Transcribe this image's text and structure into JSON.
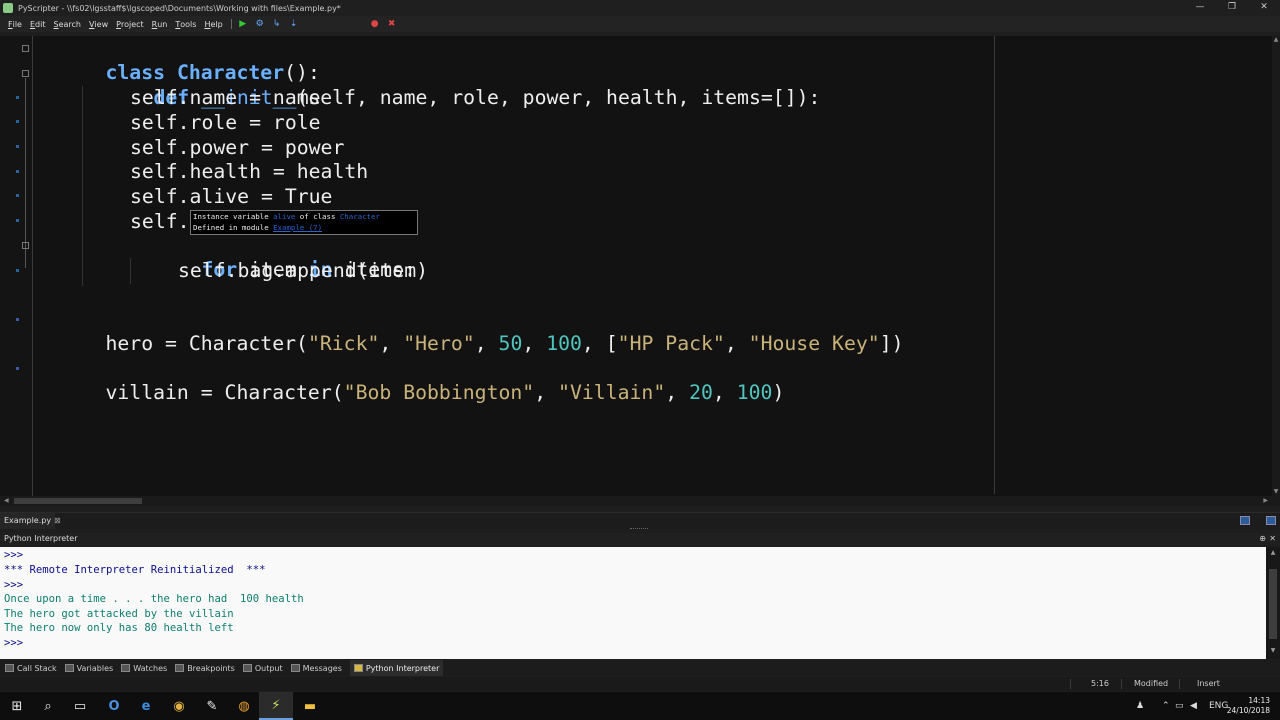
{
  "window": {
    "title": "PyScripter - \\\\fs02\\lgsstaff$\\lgscoped\\Documents\\Working with files\\Example.py*",
    "minimize": "—",
    "restore": "❐",
    "close": "✕"
  },
  "menu": {
    "items": [
      {
        "first": "F",
        "rest": "ile"
      },
      {
        "first": "E",
        "rest": "dit"
      },
      {
        "first": "S",
        "rest": "earch"
      },
      {
        "first": "V",
        "rest": "iew"
      },
      {
        "first": "P",
        "rest": "roject"
      },
      {
        "first": "R",
        "rest": "un"
      },
      {
        "first": "T",
        "rest": "ools"
      },
      {
        "first": "H",
        "rest": "elp"
      }
    ],
    "toolbar_icons": [
      "run-icon",
      "debug-icon",
      "step-into-icon",
      "step-over-icon",
      "abort-icon",
      "clear-breakpoints-icon"
    ]
  },
  "editor": {
    "lines": [
      [
        "class",
        " ",
        "Character",
        "():"
      ],
      [
        "def",
        " ",
        "__init__",
        "(self, name, role, power, health, items=[]):"
      ],
      [
        "self.name = name"
      ],
      [
        "self.role = role"
      ],
      [
        "self.power = power"
      ],
      [
        "self.health = health"
      ],
      [
        "self.alive = ",
        "True"
      ],
      [
        "self."
      ],
      [
        "for",
        " item ",
        "in",
        " items:"
      ],
      [
        "self.bag.append(item)"
      ],
      [
        "hero = Character(",
        "\"Rick\"",
        ", ",
        "\"Hero\"",
        ", ",
        "50",
        ", ",
        "100",
        ", [",
        "\"HP Pack\"",
        ", ",
        "\"House Key\"",
        "])"
      ],
      [
        "villain = Character(",
        "\"Bob Bobbington\"",
        ", ",
        "\"Villain\"",
        ", ",
        "20",
        ", ",
        "100",
        ")"
      ]
    ]
  },
  "tooltip": {
    "line1_a": "Instance variable ",
    "line1_b": "alive",
    "line1_c": " of class ",
    "line1_d": "Character",
    "line2_a": "Defined in module ",
    "line2_b": "Example (7)"
  },
  "file_tab": {
    "name": "Example.py",
    "close": "⊠"
  },
  "interpreter": {
    "title": "Python Interpreter",
    "pin": "⊕",
    "close": "✕",
    "lines": [
      {
        "text": ">>>",
        "kind": "prompt"
      },
      {
        "text": "*** Remote Interpreter Reinitialized  ***",
        "kind": "sys"
      },
      {
        "text": ">>>",
        "kind": "prompt"
      },
      {
        "text": "Once upon a time . . . the hero had  100 health",
        "kind": "out"
      },
      {
        "text": "The hero got attacked by the villain",
        "kind": "out"
      },
      {
        "text": "The hero now only has 80 health left",
        "kind": "out"
      },
      {
        "text": ">>>",
        "kind": "prompt"
      }
    ]
  },
  "tool_tabs": [
    {
      "label": "Call Stack",
      "icon": "call-stack-icon"
    },
    {
      "label": "Variables",
      "icon": "variables-icon"
    },
    {
      "label": "Watches",
      "icon": "watches-icon"
    },
    {
      "label": "Breakpoints",
      "icon": "breakpoints-icon"
    },
    {
      "label": "Output",
      "icon": "output-icon"
    },
    {
      "label": "Messages",
      "icon": "messages-icon"
    },
    {
      "label": "Python Interpreter",
      "icon": "python-icon",
      "active": true
    }
  ],
  "status": {
    "position": "5:16",
    "modified": "Modified",
    "mode": "Insert"
  },
  "taskbar": {
    "apps": [
      {
        "glyph": "⊞",
        "name": "start-icon"
      },
      {
        "glyph": "⌕",
        "name": "search-icon"
      },
      {
        "glyph": "▭",
        "name": "task-view-icon"
      },
      {
        "glyph": "O",
        "name": "outlook-icon"
      },
      {
        "glyph": "e",
        "name": "edge-icon"
      },
      {
        "glyph": "◉",
        "name": "chrome-icon"
      },
      {
        "glyph": "✎",
        "name": "snipping-tool-icon"
      },
      {
        "glyph": "◍",
        "name": "firefox-icon"
      },
      {
        "glyph": "⚡",
        "name": "pyscripter-icon",
        "active": true
      },
      {
        "glyph": "▬",
        "name": "file-explorer-icon"
      }
    ],
    "language": "ENG",
    "time": "14:13",
    "date": "24/10/2018",
    "colors": {
      "accent": "#6aa0e0"
    }
  }
}
